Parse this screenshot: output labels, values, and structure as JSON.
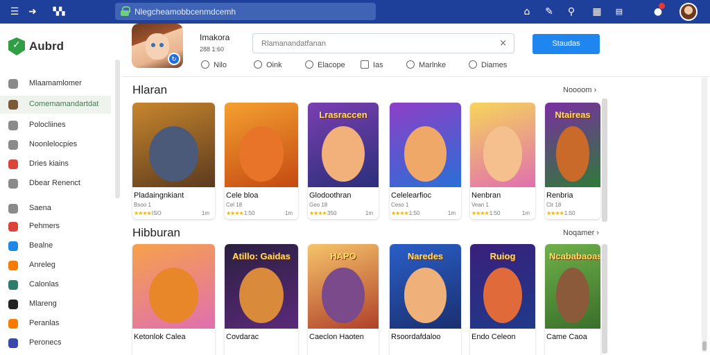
{
  "topbar": {
    "url": "Nlegcheamobbcenmdcemh",
    "icons": [
      "menu-icon",
      "arrow-icon",
      "grid-icon",
      "home-icon",
      "edit-icon",
      "search-icon",
      "table-icon",
      "chat-icon",
      "notification-icon"
    ]
  },
  "sidebar": {
    "logo_text": "Aubrd",
    "items": [
      {
        "label": "Mlaamamlomer",
        "color": "#8a8a8a"
      },
      {
        "label": "Comemamandartdat",
        "color": "#7b5a3a",
        "active": true
      },
      {
        "label": "Polocliines",
        "color": "#8a8a8a"
      },
      {
        "label": "Noonlelocpies",
        "color": "#8a8a8a"
      },
      {
        "label": "Dries kiains",
        "color": "#d9453b"
      },
      {
        "label": "Dbear Renenct",
        "color": "#8a8a8a"
      },
      {
        "label": "Saena",
        "color": "#8a8a8a"
      },
      {
        "label": "Pehmers",
        "color": "#d9453b"
      },
      {
        "label": "Bealne",
        "color": "#1e88e5"
      },
      {
        "label": "Anreleg",
        "color": "#f57c00"
      },
      {
        "label": "Calonlas",
        "color": "#2e7d6b"
      },
      {
        "label": "Mlareng",
        "color": "#222222"
      },
      {
        "label": "Peranlas",
        "color": "#f57c00"
      },
      {
        "label": "Peronecs",
        "color": "#3949ab"
      }
    ]
  },
  "header": {
    "app_name": "Imakora",
    "app_sub": "288 1:60",
    "search_placeholder": "Rlamanandatfanan",
    "button_label": "Staudas",
    "tabs": [
      {
        "label": "Nilo"
      },
      {
        "label": "Oink"
      },
      {
        "label": "Elacope"
      },
      {
        "label": "Ias"
      },
      {
        "label": "Marlnke"
      },
      {
        "label": "Diames"
      }
    ]
  },
  "sections": [
    {
      "title": "Hlaran",
      "more": "Noooom",
      "cards": [
        {
          "name": "Pladaingnkiant",
          "meta": "Bsoo 1",
          "rating": "ISO",
          "size": "1m",
          "bg1": "#c8862d",
          "bg2": "#5b3a1e",
          "blob": "#4a5a78"
        },
        {
          "name": "Cele bloa",
          "meta": "Cel 18",
          "rating": "1:50",
          "size": "1m",
          "bg1": "#f4a030",
          "bg2": "#c44a12",
          "blob": "#e8742a"
        },
        {
          "name": "Glodoothran",
          "meta": "Geo 18",
          "rating": "350",
          "size": "1m",
          "bg1": "#7a3fb0",
          "bg2": "#2a2f7a",
          "blob": "#f2b07a",
          "ttl": "Lrasraccen"
        },
        {
          "name": "Celelearfioc",
          "meta": "Ceso 1",
          "rating": "1:50",
          "size": "1m",
          "bg1": "#8e3fc7",
          "bg2": "#2a6fd6",
          "blob": "#f0a868"
        },
        {
          "name": "Nenbran",
          "meta": "Vean 1",
          "rating": "1:50",
          "size": "1m",
          "bg1": "#f6d55a",
          "bg2": "#e06fb0",
          "blob": "#f5c08e"
        },
        {
          "name": "Renbria",
          "meta": "Clr 18",
          "rating": "1:50",
          "size": "",
          "bg1": "#7a2fa0",
          "bg2": "#2f7a3a",
          "blob": "#c96a2b",
          "ttl": "Ntaireas"
        }
      ]
    },
    {
      "title": "Hibburan",
      "more": "Noqamer",
      "cards": [
        {
          "name": "Ketonlok Calea",
          "meta": "",
          "rating": "",
          "size": "",
          "bg1": "#f7a14a",
          "bg2": "#e06fb0",
          "blob": "#e8862a"
        },
        {
          "name": "Covdarac",
          "meta": "",
          "rating": "",
          "size": "",
          "bg1": "#2a1f3f",
          "bg2": "#5b2a7a",
          "blob": "#d98a3a",
          "ttl": "Atillo: Gaidas"
        },
        {
          "name": "Caeclon Haoten",
          "meta": "",
          "rating": "",
          "size": "",
          "bg1": "#f6c46a",
          "bg2": "#b0402a",
          "blob": "#7a4a8a",
          "ttl": "HAPO"
        },
        {
          "name": "Rsoordafdaloo",
          "meta": "",
          "rating": "",
          "size": "",
          "bg1": "#2a5fc7",
          "bg2": "#1a2f6f",
          "blob": "#f0b07a",
          "ttl": "Naredes"
        },
        {
          "name": "Endo Celeon",
          "meta": "",
          "rating": "",
          "size": "",
          "bg1": "#3a1f7a",
          "bg2": "#1f3a8a",
          "blob": "#e06a3a",
          "ttl": "Ruiog"
        },
        {
          "name": "Came Caoa",
          "meta": "",
          "rating": "",
          "size": "",
          "bg1": "#6fb04a",
          "bg2": "#3a6f2a",
          "blob": "#8a5a3a",
          "ttl": "Ncababaoas"
        }
      ]
    }
  ]
}
